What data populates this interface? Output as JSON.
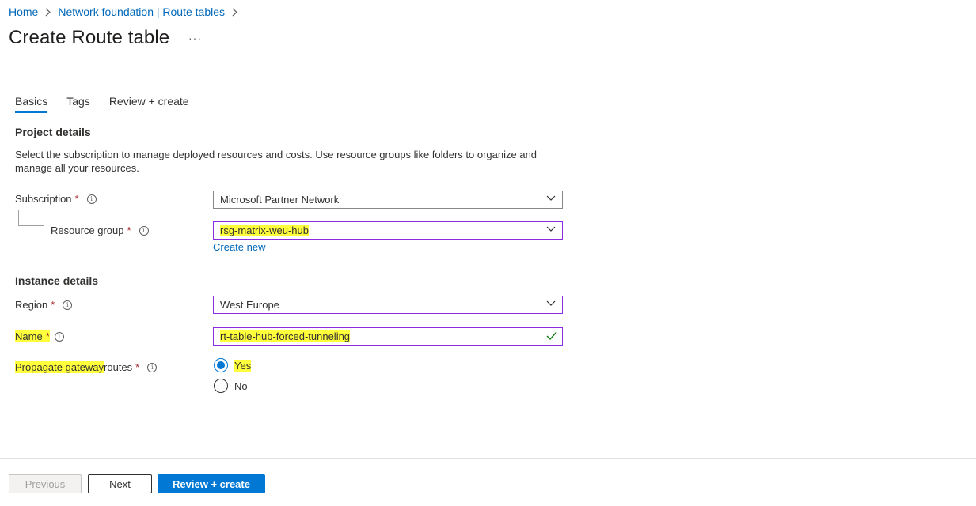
{
  "breadcrumb": {
    "items": [
      "Home",
      "Network foundation | Route tables"
    ]
  },
  "page": {
    "title": "Create Route table",
    "more": "···"
  },
  "tabs": [
    {
      "label": "Basics",
      "active": true
    },
    {
      "label": "Tags",
      "active": false
    },
    {
      "label": "Review + create",
      "active": false
    }
  ],
  "project": {
    "heading": "Project details",
    "description": "Select the subscription to manage deployed resources and costs. Use resource groups like folders to organize and manage all your resources.",
    "subscription_label": "Subscription",
    "subscription_value": "Microsoft Partner Network",
    "resource_group_label": "Resource group",
    "resource_group_value": "rsg-matrix-weu-hub",
    "create_new": "Create new"
  },
  "instance": {
    "heading": "Instance details",
    "region_label": "Region",
    "region_value": "West Europe",
    "name_label": "Name",
    "name_value": "rt-table-hub-forced-tunneling",
    "propagate_label_hl": "Propagate gateway ",
    "propagate_label_rest": "routes",
    "options": [
      "Yes",
      "No"
    ],
    "selected": "Yes"
  },
  "required_mark": "*",
  "info_glyph": "i",
  "footer": {
    "previous": "Previous",
    "next": "Next",
    "review": "Review + create"
  },
  "colors": {
    "accent": "#0078d4",
    "link": "#0067b8",
    "highlight": "#ffff3c",
    "focus_border": "#8a2be2",
    "required": "#a4262c",
    "valid_check": "#107c10"
  }
}
